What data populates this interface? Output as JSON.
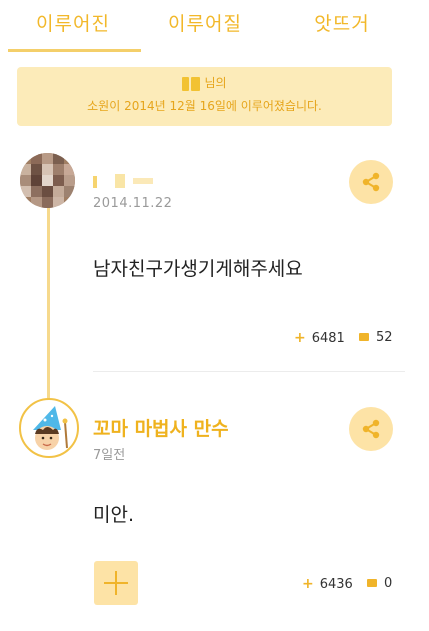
{
  "tabs": [
    {
      "label": "이루어진",
      "active": true
    },
    {
      "label": "이루어질",
      "active": false
    },
    {
      "label": "앗뜨거",
      "active": false
    }
  ],
  "banner": {
    "line1_suffix": "님의",
    "line2": "소원이 2014년 12월 16일에 이루어졌습니다."
  },
  "wish": {
    "date": "2014.11.22",
    "text": "남자친구가생기게해주세요",
    "likes": "6481",
    "comments": "52"
  },
  "reply": {
    "author": "꼬마 마법사 만수",
    "time": "7일전",
    "text": "미안.",
    "likes": "6436",
    "comments": "0"
  },
  "icons": {
    "share": "share-icon",
    "like": "plus-icon",
    "comment": "speech-bubble-icon",
    "add": "plus-icon"
  },
  "colors": {
    "accent": "#f0b42a",
    "banner_bg": "#fcebb9",
    "button_bg": "#fde3a6"
  }
}
